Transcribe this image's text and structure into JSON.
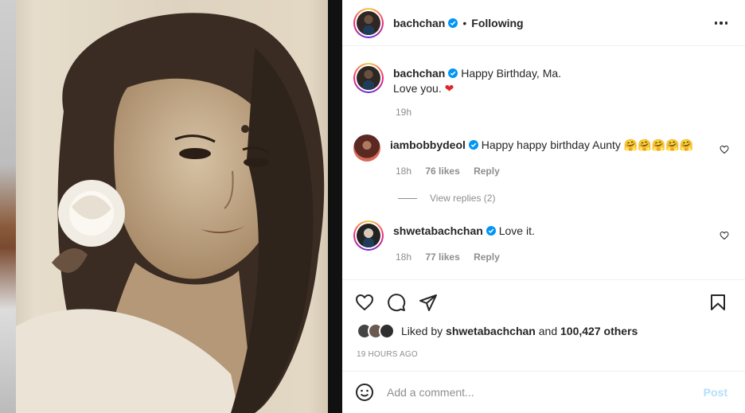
{
  "post": {
    "username": "bachchan",
    "follow_status": "Following",
    "dot": "•"
  },
  "caption": {
    "username": "bachchan",
    "text_line1": "Happy Birthday, Ma.",
    "text_line2": "Love you.",
    "emoji": "❤",
    "time": "19h"
  },
  "comments": [
    {
      "username": "iambobbydeol",
      "text": "Happy happy birthday Aunty",
      "emojis": "🤗🤗🤗🤗🤗",
      "time": "18h",
      "likes": "76 likes",
      "reply": "Reply",
      "view_replies": "View replies (2)"
    },
    {
      "username": "shwetabachchan",
      "text": "Love it.",
      "time": "18h",
      "likes": "77 likes",
      "reply": "Reply"
    }
  ],
  "liked_by": {
    "prefix": "Liked by",
    "user": "shwetabachchan",
    "and": "and",
    "others": "100,427 others"
  },
  "time_ago": "19 HOURS AGO",
  "comment_box": {
    "placeholder": "Add a comment...",
    "post_label": "Post"
  },
  "icons": {
    "like": "heart-icon",
    "comment": "comment-icon",
    "share": "share-icon",
    "save": "bookmark-icon",
    "emoji": "emoji-icon",
    "more": "more-icon",
    "verified": "verified-badge-icon"
  },
  "colors": {
    "verified": "#0095f6",
    "post_disabled": "#b2dffc",
    "heart_red": "#e0242c"
  }
}
